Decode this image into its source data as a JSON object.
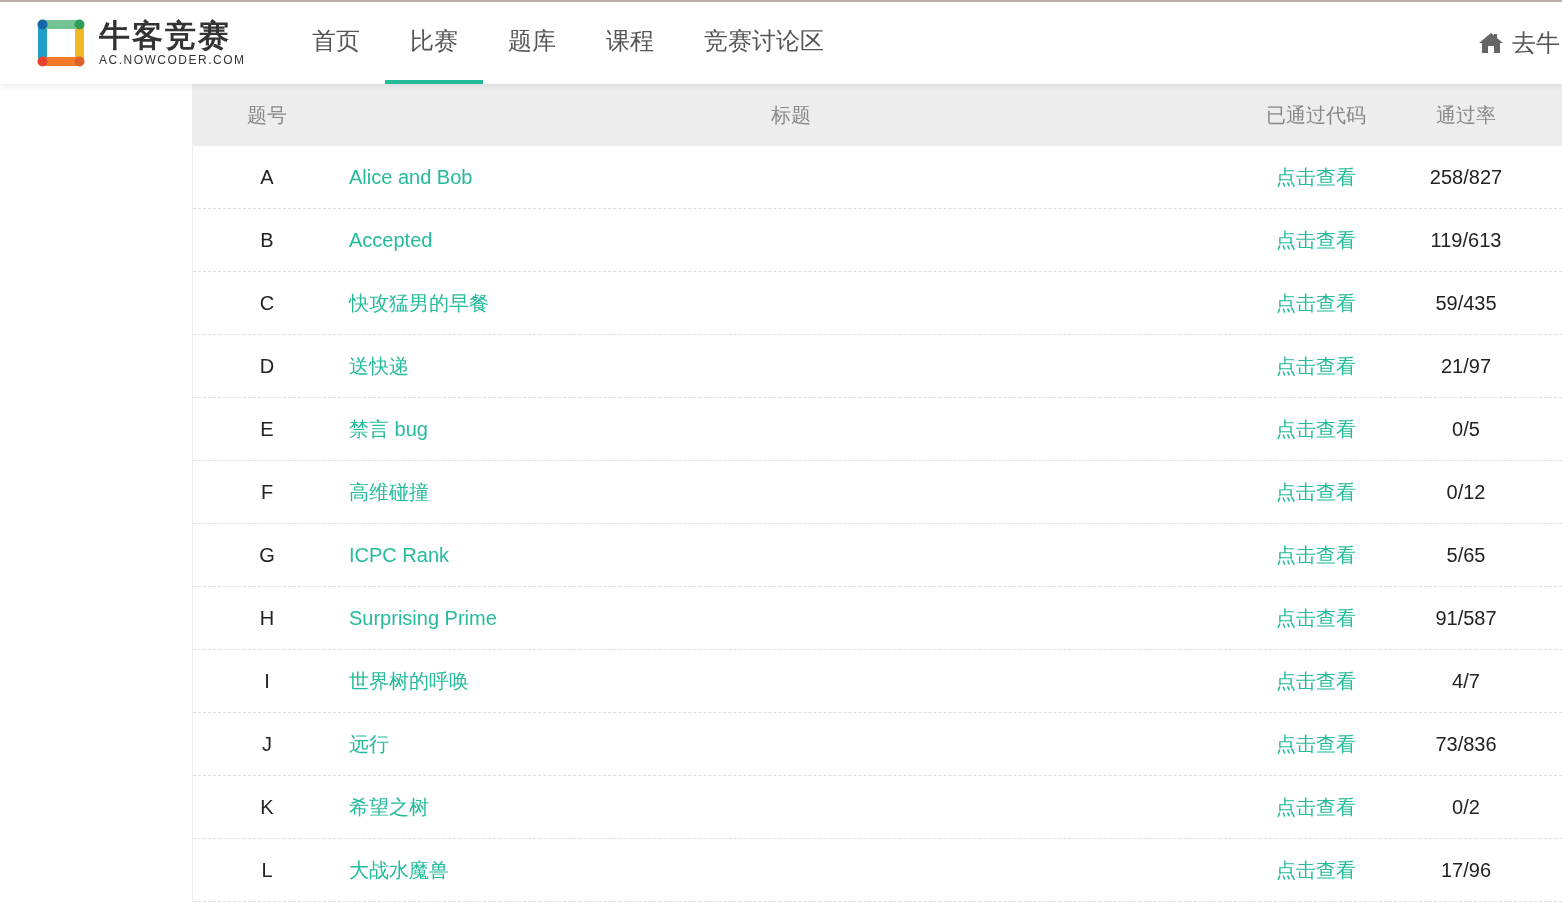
{
  "header": {
    "logo": {
      "title": "牛客竞赛",
      "subtitle": "AC.NOWCODER.COM"
    },
    "nav": [
      {
        "label": "首页",
        "selected": false
      },
      {
        "label": "比赛",
        "selected": true
      },
      {
        "label": "题库",
        "selected": false
      },
      {
        "label": "课程",
        "selected": false
      },
      {
        "label": "竞赛讨论区",
        "selected": false
      }
    ],
    "home_link": "去牛"
  },
  "table": {
    "columns": [
      "题号",
      "标题",
      "已通过代码",
      "通过率"
    ],
    "rows": [
      {
        "id": "A",
        "title": "Alice and Bob",
        "code": "点击查看",
        "rate": "258/827"
      },
      {
        "id": "B",
        "title": "Accepted",
        "code": "点击查看",
        "rate": "119/613"
      },
      {
        "id": "C",
        "title": "快攻猛男的早餐",
        "code": "点击查看",
        "rate": "59/435"
      },
      {
        "id": "D",
        "title": "送快递",
        "code": "点击查看",
        "rate": "21/97"
      },
      {
        "id": "E",
        "title": "禁言 bug",
        "code": "点击查看",
        "rate": "0/5"
      },
      {
        "id": "F",
        "title": "高维碰撞",
        "code": "点击查看",
        "rate": "0/12"
      },
      {
        "id": "G",
        "title": "ICPC Rank",
        "code": "点击查看",
        "rate": "5/65"
      },
      {
        "id": "H",
        "title": "Surprising Prime",
        "code": "点击查看",
        "rate": "91/587"
      },
      {
        "id": "I",
        "title": "世界树的呼唤",
        "code": "点击查看",
        "rate": "4/7"
      },
      {
        "id": "J",
        "title": "远行",
        "code": "点击查看",
        "rate": "73/836"
      },
      {
        "id": "K",
        "title": "希望之树",
        "code": "点击查看",
        "rate": "0/2"
      },
      {
        "id": "L",
        "title": "大战水魔兽",
        "code": "点击查看",
        "rate": "17/96"
      }
    ]
  }
}
